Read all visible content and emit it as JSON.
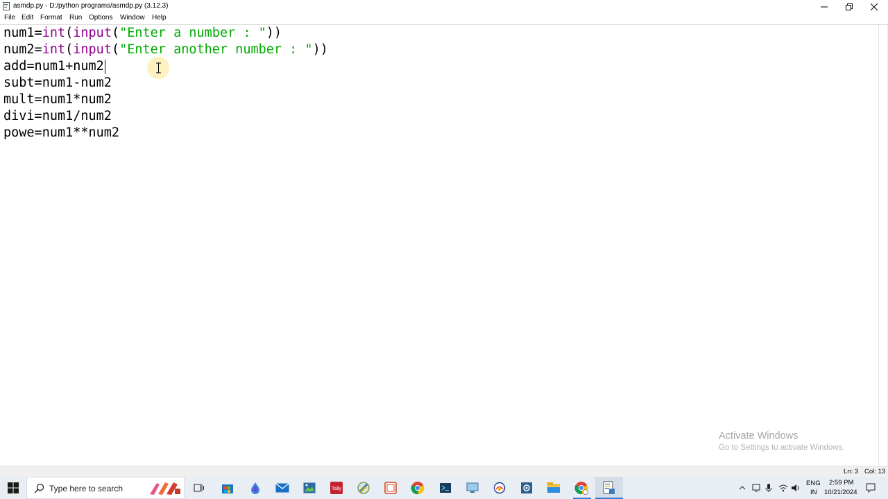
{
  "window": {
    "title": "asmdp.py - D:/python programs/asmdp.py (3.12.3)"
  },
  "menu": [
    "File",
    "Edit",
    "Format",
    "Run",
    "Options",
    "Window",
    "Help"
  ],
  "editor": {
    "line1": {
      "a": "num1=",
      "b": "int",
      "c": "(",
      "d": "input",
      "e": "(",
      "f": "\"Enter a number : \"",
      "g": "))"
    },
    "line2": {
      "a": "num2=",
      "b": "int",
      "c": "(",
      "d": "input",
      "e": "(",
      "f": "\"Enter another number : \"",
      "g": "))"
    },
    "line3": "add=num1+num2",
    "line4": "subt=num1-num2",
    "line5": "mult=num1*num2",
    "line6": "divi=num1/num2",
    "line7": "powe=num1**num2"
  },
  "watermark": {
    "title": "Activate Windows",
    "subtitle": "Go to Settings to activate Windows."
  },
  "status": {
    "line": "Ln: 3",
    "col": "Col: 13"
  },
  "taskbar": {
    "search_placeholder": "Type here to search",
    "icons": [
      "search-icon",
      "paint-icon",
      "task-view-icon",
      "store-icon",
      "drop-app-icon",
      "mail-icon",
      "photos-icon",
      "tally-icon",
      "python-idle-icon",
      "office-icon",
      "chrome-icon",
      "terminal-icon",
      "monitor-icon",
      "vpn-icon",
      "settings-icon",
      "explorer-icon",
      "chrome-profile-icon",
      "python-editor-icon"
    ],
    "lang_top": "ENG",
    "lang_bottom": "IN",
    "time": "2:59 PM",
    "date": "10/21/2024"
  },
  "colors": {
    "keyword": "#900090",
    "string": "#00aa00",
    "watermark": "#a8a8a8"
  }
}
